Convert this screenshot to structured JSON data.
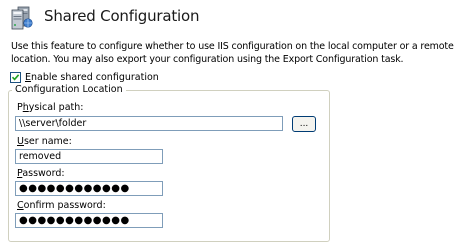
{
  "header": {
    "title": "Shared Configuration",
    "icon": "server-icon"
  },
  "description": "Use this feature to configure whether to use IIS configuration on the local computer or a remote location. You may also export your configuration using the Export Configuration task.",
  "enable_shared": {
    "label_accel": "E",
    "label_rest": "nable shared configuration",
    "checked": true
  },
  "configuration_location": {
    "title": "Configuration Location",
    "physical_path": {
      "label_accel": "h",
      "label_pre": "P",
      "label_post": "ysical path:",
      "value": "\\\\server\\folder",
      "browse_label": "..."
    },
    "user_name": {
      "label_accel": "U",
      "label_rest": "ser name:",
      "value": "removed"
    },
    "password": {
      "label_accel": "P",
      "label_rest": "assword:",
      "value": "●●●●●●●●●●●●"
    },
    "confirm_password": {
      "label_accel": "C",
      "label_rest": "onfirm password:",
      "value": "●●●●●●●●●●●●"
    }
  },
  "colors": {
    "input_border": "#7f9db9",
    "group_border": "#d0d0bf",
    "checkbox_border": "#1c5180",
    "checkmark": "#21a121"
  }
}
